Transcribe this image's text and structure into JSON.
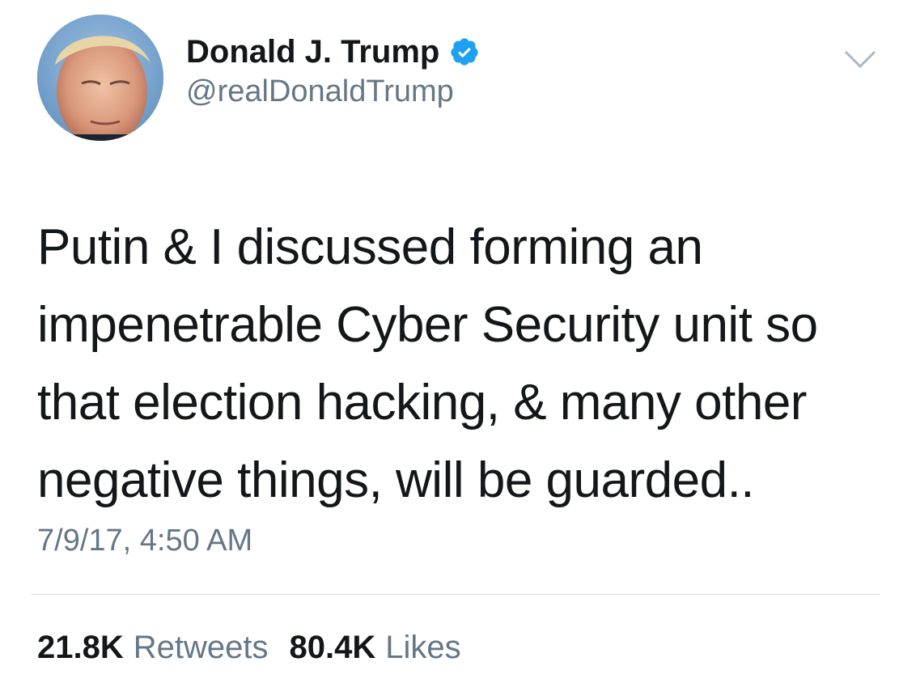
{
  "author": {
    "display_name": "Donald J. Trump",
    "handle": "@realDonaldTrump",
    "verified": true
  },
  "tweet": {
    "text": "Putin & I discussed forming an\nimpenetrable Cyber Security unit    so\nthat election hacking, & many other\nnegative things, will be guarded..",
    "timestamp": "7/9/17, 4:50 AM"
  },
  "stats": {
    "retweets_count": "21.8K",
    "retweets_label": "Retweets",
    "likes_count": "80.4K",
    "likes_label": "Likes"
  },
  "colors": {
    "text": "#14171a",
    "secondary": "#657786",
    "verified_blue": "#1da1f2",
    "divider": "#d7dde2"
  },
  "icons": {
    "verified": "verified-badge-icon",
    "menu": "chevron-down-icon"
  }
}
